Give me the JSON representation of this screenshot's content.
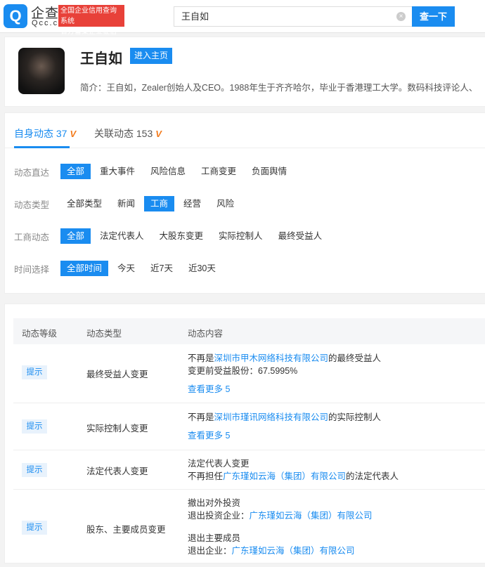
{
  "header": {
    "logo_text": "企查查",
    "logo_sub": "Qcc.com",
    "slogan_line1": "全国企业信用查询系统",
    "slogan_line2": "官方备案企业征信机构",
    "search_value": "王自如",
    "search_button": "查一下"
  },
  "profile": {
    "name": "王自如",
    "home_button": "进入主页",
    "bio": "简介：王自如，Zealer创始人及CEO。1988年生于齐齐哈尔，毕业于香港理工大学。数码科技评论人、"
  },
  "tabs": [
    {
      "label": "自身动态",
      "count": "37"
    },
    {
      "label": "关联动态",
      "count": "153"
    }
  ],
  "filters": [
    {
      "label": "动态直达",
      "options": [
        "全部",
        "重大事件",
        "风险信息",
        "工商变更",
        "负面舆情"
      ]
    },
    {
      "label": "动态类型",
      "options": [
        "全部类型",
        "新闻",
        "工商",
        "经营",
        "风险"
      ]
    },
    {
      "label": "工商动态",
      "options": [
        "全部",
        "法定代表人",
        "大股东变更",
        "实际控制人",
        "最终受益人"
      ]
    },
    {
      "label": "时间选择",
      "options": [
        "全部时间",
        "今天",
        "近7天",
        "近30天"
      ]
    }
  ],
  "table": {
    "headers": [
      "动态等级",
      "动态类型",
      "动态内容"
    ],
    "rows": [
      {
        "level": "提示",
        "type": "最终受益人变更",
        "pre": "不再是",
        "company": "深圳市甲木网络科技有限公司",
        "post": "的最终受益人",
        "line2": "变更前受益股份：67.5995%",
        "more": "查看更多 5"
      },
      {
        "level": "提示",
        "type": "实际控制人变更",
        "pre": "不再是",
        "company": "深圳市瑾讯网络科技有限公司",
        "post": "的实际控制人",
        "more": "查看更多 5"
      },
      {
        "level": "提示",
        "type": "法定代表人变更",
        "line1": "法定代表人变更",
        "pre": "不再担任",
        "company": "广东瑾如云海（集团）有限公司",
        "post": "的法定代表人"
      },
      {
        "level": "提示",
        "type": "股东、主要成员变更",
        "line1": "撤出对外投资",
        "label2": "退出投资企业：",
        "company": "广东瑾如云海（集团）有限公司",
        "line3": "退出主要成员",
        "label4": "退出企业：",
        "company2": "广东瑾如云海（集团）有限公司"
      }
    ]
  }
}
